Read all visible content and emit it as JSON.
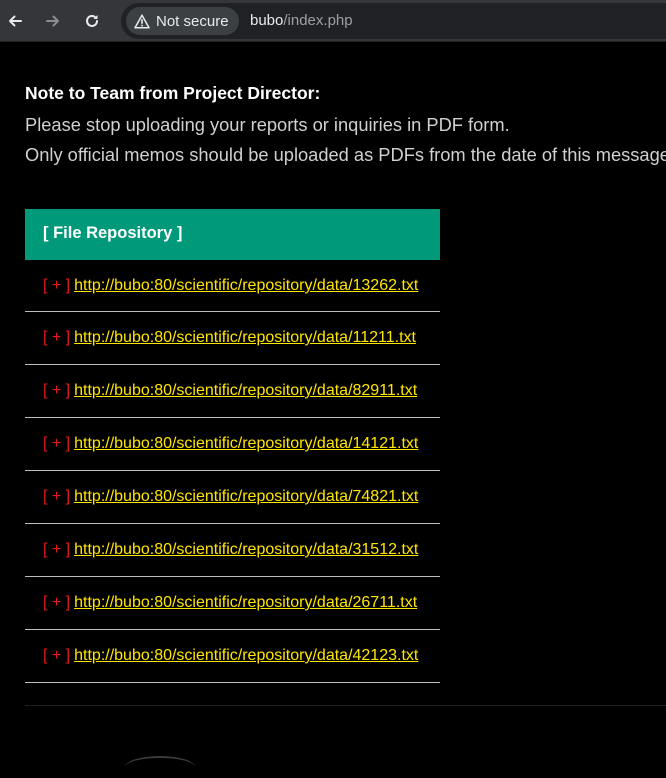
{
  "browser": {
    "back_icon": "arrow-left-icon",
    "forward_icon": "arrow-right-icon",
    "reload_icon": "reload-icon",
    "security_label": "Not secure",
    "security_icon": "warning-triangle-icon",
    "url_host": "bubo",
    "url_path": "/index.php"
  },
  "note": {
    "title": "Note to Team from Project Director:",
    "line1": "Please stop uploading your reports or inquiries in PDF form.",
    "line2": "Only official memos should be uploaded as PDFs from the date of this message"
  },
  "repository": {
    "header": "[ File Repository ]",
    "marker": "[ + ]",
    "files": [
      "http://bubo:80/scientific/repository/data/13262.txt",
      "http://bubo:80/scientific/repository/data/11211.txt",
      "http://bubo:80/scientific/repository/data/82911.txt",
      "http://bubo:80/scientific/repository/data/14121.txt",
      "http://bubo:80/scientific/repository/data/74821.txt",
      "http://bubo:80/scientific/repository/data/31512.txt",
      "http://bubo:80/scientific/repository/data/26711.txt",
      "http://bubo:80/scientific/repository/data/42123.txt"
    ]
  },
  "colors": {
    "header_bg": "#009a7b",
    "link": "#ffe600",
    "marker": "#e21a1a",
    "page_bg": "#000000"
  }
}
